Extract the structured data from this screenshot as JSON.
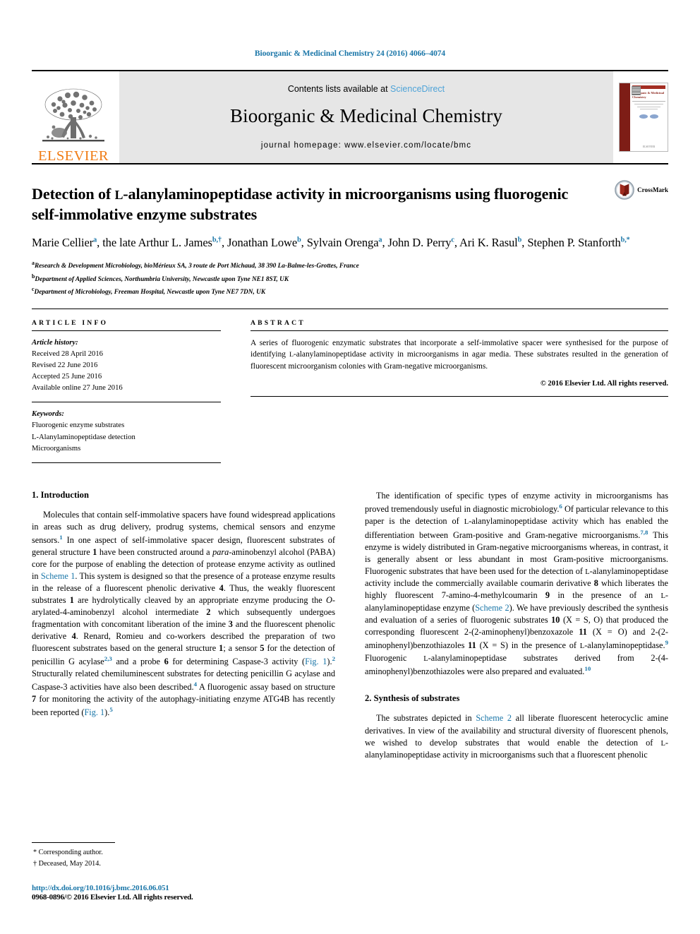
{
  "running_head": "Bioorganic & Medicinal Chemistry 24 (2016) 4066–4074",
  "masthead": {
    "publisher_logo_text": "ELSEVIER",
    "contents_prefix": "Contents lists available at ",
    "contents_link": "ScienceDirect",
    "journal_name": "Bioorganic & Medicinal Chemistry",
    "homepage_line": "journal homepage: www.elsevier.com/locate/bmc",
    "cover": {
      "title": "Bioorganic & Medicinal Chemistry",
      "subtitle": "An Tetrahedron Organic Chemistry Series in Life Sciences",
      "footer": "ELSEVIER"
    }
  },
  "article": {
    "title_line1_a": "Detection of ",
    "title_line1_sc": "L",
    "title_line1_b": "-alanylaminopeptidase activity in microorganisms",
    "title_line2": "using fluorogenic self-immolative enzyme substrates",
    "crossmark_label": "CrossMark",
    "authors": [
      {
        "name": "Marie Cellier",
        "sup": "a",
        "sep": ", "
      },
      {
        "name": "the late Arthur L. James",
        "sup": "b,†",
        "sep": ", "
      },
      {
        "name": "Jonathan Lowe",
        "sup": "b",
        "sep": ", "
      },
      {
        "name": "Sylvain Orenga",
        "sup": "a",
        "sep": ", "
      },
      {
        "name": "John D. Perry",
        "sup": "c",
        "sep": ", "
      },
      {
        "name": "Ari K. Rasul",
        "sup": "b",
        "sep": ", "
      },
      {
        "name": "Stephen P. Stanforth",
        "sup": "b,*",
        "sep": ""
      }
    ],
    "affiliations": [
      {
        "mark": "a",
        "text": "Research & Development Microbiology, bioMérieux SA, 3 route de Port Michaud, 38 390 La-Balme-les-Grottes, France"
      },
      {
        "mark": "b",
        "text": "Department of Applied Sciences, Northumbria University, Newcastle upon Tyne NE1 8ST, UK"
      },
      {
        "mark": "c",
        "text": "Department of Microbiology, Freeman Hospital, Newcastle upon Tyne NE7 7DN, UK"
      }
    ]
  },
  "article_info": {
    "heading": "ARTICLE INFO",
    "history_label": "Article history:",
    "history": [
      "Received 28 April 2016",
      "Revised 22 June 2016",
      "Accepted 25 June 2016",
      "Available online 27 June 2016"
    ],
    "keywords_label": "Keywords:",
    "keywords": [
      "Fluorogenic enzyme substrates",
      "L-Alanylaminopeptidase detection",
      "Microorganisms"
    ]
  },
  "abstract": {
    "heading": "ABSTRACT",
    "text_part1": "A series of fluorogenic enzymatic substrates that incorporate a self-immolative spacer were synthesised for the purpose of identifying ",
    "text_sc": "L",
    "text_part2": "-alanylaminopeptidase activity in microorganisms in agar media. These substrates resulted in the generation of fluorescent microorganism colonies with Gram-negative microorganisms.",
    "copyright": "© 2016 Elsevier Ltd. All rights reserved."
  },
  "body": {
    "left": {
      "section_heading": "1. Introduction",
      "p1_s1": "Molecules that contain self-immolative spacers have found widespread applications in areas such as drug delivery, prodrug systems, chemical sensors and enzyme sensors.",
      "p1_ref1": "1",
      "p1_s2": " In one aspect of self-immolative spacer design, fluorescent substrates of general structure ",
      "p1_b1": "1",
      "p1_s3": " have been constructed around a ",
      "p1_i1": "para",
      "p1_s4": "-aminobenzyl alcohol (PABA) core for the purpose of enabling the detection of protease enzyme activity as outlined in ",
      "p1_lnk1": "Scheme 1",
      "p1_s5": ". This system is designed so that the presence of a protease enzyme results in the release of a fluorescent phenolic derivative ",
      "p1_b2": "4",
      "p1_s6": ". Thus, the weakly fluorescent substrates ",
      "p1_b3": "1",
      "p1_s7": " are hydrolytically cleaved by an appropriate enzyme producing the ",
      "p1_i2": "O",
      "p1_s8": "-arylated-4-aminobenzyl alcohol intermediate ",
      "p1_b4": "2",
      "p1_s9": " which subsequently undergoes fragmentation with concomitant liberation of the imine ",
      "p1_b5": "3",
      "p1_s10": " and the fluorescent phenolic derivative ",
      "p1_b6": "4",
      "p1_s11": ". Renard, Romieu and co-workers described the preparation of two fluorescent substrates based on the general structure ",
      "p1_b7": "1",
      "p1_s12": "; a sensor ",
      "p1_b8": "5",
      "p1_s13": " for the detection of penicillin G acylase",
      "p1_ref2": "2,3",
      "p1_s14": " and a probe ",
      "p1_b9": "6",
      "p1_s15": " for determining Caspase-3 activity (",
      "p1_lnk2": "Fig. 1",
      "p1_s16": ").",
      "p1_ref3": "2",
      "p1_s17": " Structurally related chemiluminescent substrates for detecting penicillin G acylase and Caspase-3 activities have also been described.",
      "p1_ref4": "4",
      "p1_s18": " A fluorogenic assay based on structure ",
      "p1_b10": "7",
      "p1_s19": " for monitoring the activity of the autophagy-initiating enzyme ATG4B has recently been reported (",
      "p1_lnk3": "Fig. 1",
      "p1_s20": ").",
      "p1_ref5": "5"
    },
    "right": {
      "p1_s1": "The identification of specific types of enzyme activity in microorganisms has proved tremendously useful in diagnostic microbiology.",
      "p1_ref1": "6",
      "p1_s2": " Of particular relevance to this paper is the detection of ",
      "p1_sc1": "L",
      "p1_s3": "-alanylaminopeptidase activity which has enabled the differentiation between Gram-positive and Gram-negative microorganisms.",
      "p1_ref2": "7,8",
      "p1_s4": " This enzyme is widely distributed in Gram-negative microorganisms whereas, in contrast, it is generally absent or less abundant in most Gram-positive microorganisms. Fluorogenic substrates that have been used for the detection of ",
      "p1_sc2": "L",
      "p1_s5": "-alanylaminopeptidase activity include the commercially available coumarin derivative ",
      "p1_b1": "8",
      "p1_s6": " which liberates the highly fluorescent 7-amino-4-methylcoumarin ",
      "p1_b2": "9",
      "p1_s7": " in the presence of an ",
      "p1_sc3": "L",
      "p1_s8": "-alanylaminopeptidase enzyme (",
      "p1_lnk1": "Scheme 2",
      "p1_s9": "). We have previously described the synthesis and evaluation of a series of fluorogenic substrates ",
      "p1_b3": "10",
      "p1_s10": " (X = S, O) that produced the corresponding fluorescent 2-(2-aminophenyl)benzoxazole ",
      "p1_b4": "11",
      "p1_s11": " (X = O) and 2-(2-aminophenyl)benzothiazoles ",
      "p1_b5": "11",
      "p1_s12": " (X = S) in the presence of ",
      "p1_sc4": "L",
      "p1_s13": "-alanylaminopeptidase.",
      "p1_ref3": "9",
      "p1_s14": " Fluorogenic ",
      "p1_sc5": "L",
      "p1_s15": "-alanylaminopeptidase substrates derived from 2-(4-aminophenyl)benzothiazoles were also prepared and evaluated.",
      "p1_ref4": "10",
      "section_heading": "2. Synthesis of substrates",
      "p2_s1": "The substrates depicted in ",
      "p2_lnk1": "Scheme 2",
      "p2_s2": " all liberate fluorescent heterocyclic amine derivatives. In view of the availability and structural diversity of fluorescent phenols, we wished to develop substrates that would enable the detection of ",
      "p2_sc1": "L",
      "p2_s3": "-alanylaminopeptidase activity in microorganisms such that a fluorescent phenolic"
    }
  },
  "footnotes": [
    {
      "mark": "*",
      "text": "Corresponding author."
    },
    {
      "mark": "†",
      "text": "Deceased, May 2014."
    }
  ],
  "footer": {
    "doi": "http://dx.doi.org/10.1016/j.bmc.2016.06.051",
    "issn_line": "0968-0896/© 2016 Elsevier Ltd. All rights reserved."
  },
  "colors": {
    "link": "#1a76a8",
    "sciencedirect": "#4ea3d8",
    "elsevier_orange": "#f07c15",
    "cover_maroon": "#7e1d16"
  }
}
